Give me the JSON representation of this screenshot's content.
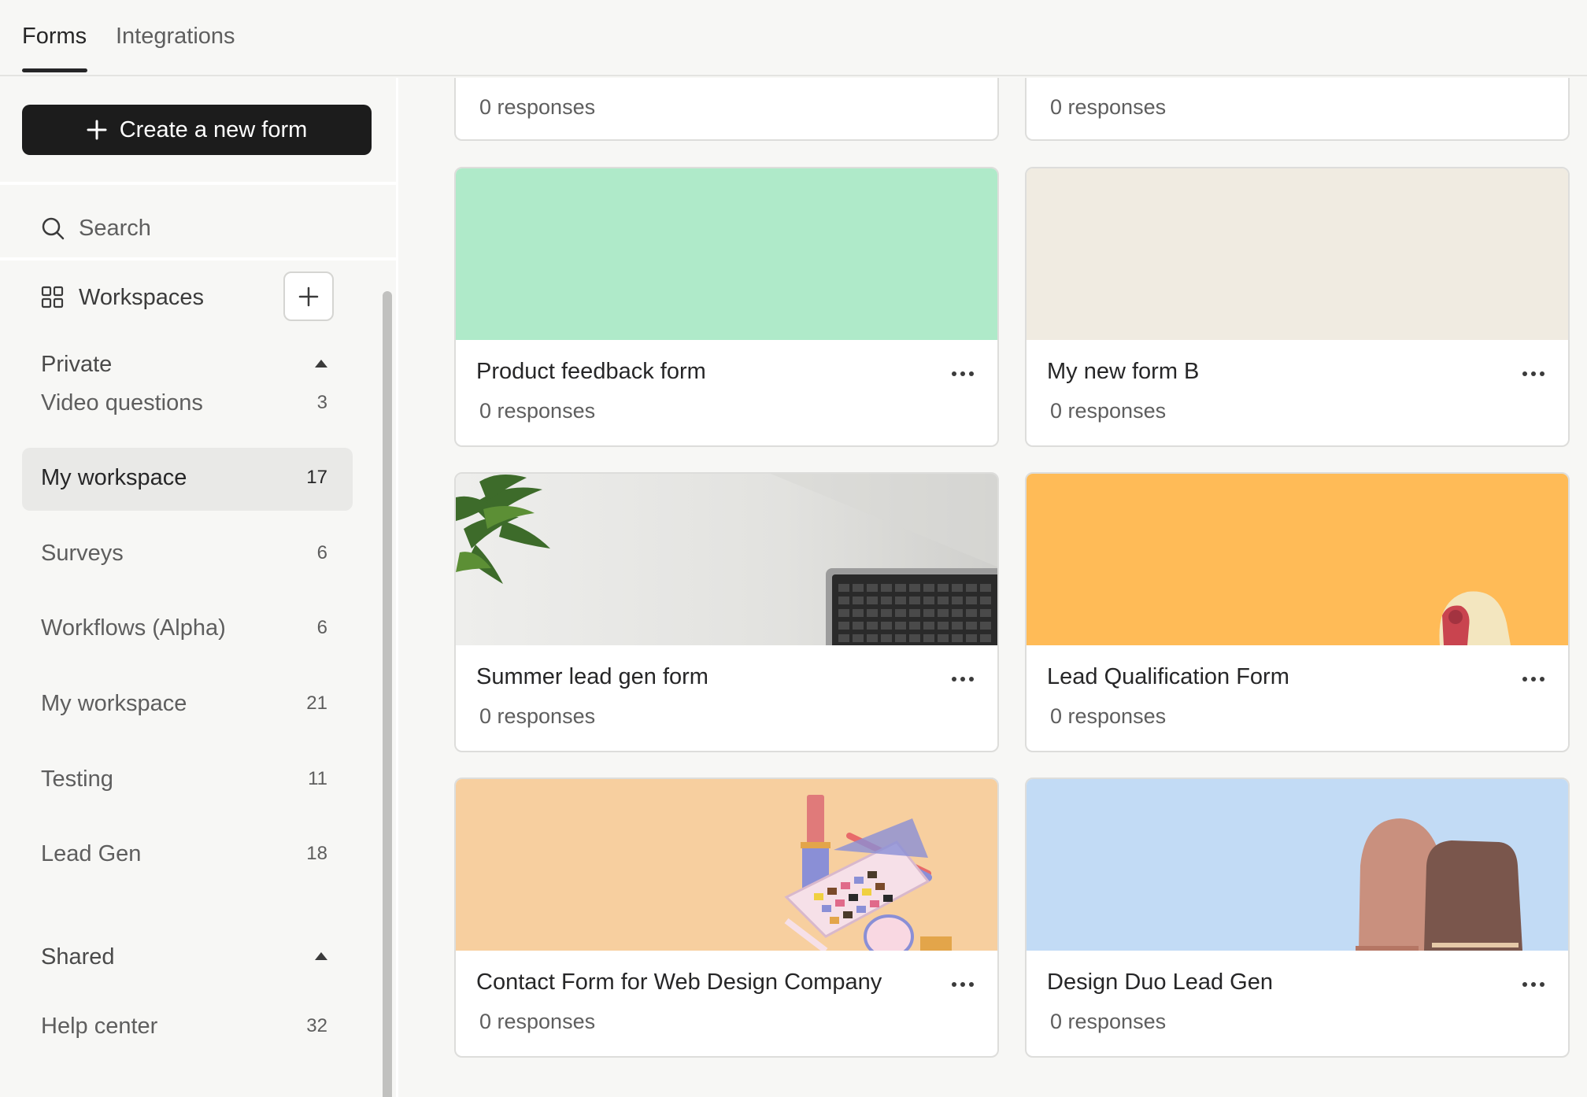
{
  "tabs": [
    {
      "label": "Forms",
      "active": true
    },
    {
      "label": "Integrations",
      "active": false
    }
  ],
  "sidebar": {
    "create_label": "Create a new form",
    "search_label": "Search",
    "workspaces_label": "Workspaces",
    "private_label": "Private",
    "shared_label": "Shared",
    "workspaces": [
      {
        "name": "Video questions",
        "count": "3"
      },
      {
        "name": "My workspace",
        "count": "17",
        "selected": true
      },
      {
        "name": "Surveys",
        "count": "6"
      },
      {
        "name": "Workflows (Alpha)",
        "count": "6"
      },
      {
        "name": "My workspace",
        "count": "21"
      },
      {
        "name": "Testing",
        "count": "11"
      },
      {
        "name": "Lead Gen",
        "count": "18"
      }
    ],
    "shared_workspaces": [
      {
        "name": "Help center",
        "count": "32"
      }
    ]
  },
  "forms": [
    {
      "title": "",
      "responses": "0 responses",
      "cover": "partial"
    },
    {
      "title": "",
      "responses": "0 responses",
      "cover": "partial"
    },
    {
      "title": "Product feedback form",
      "responses": "0 responses",
      "cover": "mint"
    },
    {
      "title": "My new form B",
      "responses": "0 responses",
      "cover": "beige"
    },
    {
      "title": "Summer lead gen form",
      "responses": "0 responses",
      "cover": "desk-photo"
    },
    {
      "title": "Lead Qualification Form",
      "responses": "0 responses",
      "cover": "orange-illustration"
    },
    {
      "title": "Contact Form for Web Design Company",
      "responses": "0 responses",
      "cover": "makeup-illustration"
    },
    {
      "title": "Design Duo Lead Gen",
      "responses": "0 responses",
      "cover": "blue-illustration"
    }
  ],
  "colors": {
    "accent_dark": "#1c1c1c",
    "cursor_highlight": "#fdb53a",
    "cover_mint": "#afeac9",
    "cover_beige": "#f0ebe1",
    "cover_orange": "#ffbb57",
    "cover_peach": "#f7cf9f",
    "cover_blue": "#c2dbf5"
  },
  "icons": [
    "plus-icon",
    "search-icon",
    "grid-icon",
    "caret-up-icon",
    "more-icon"
  ]
}
